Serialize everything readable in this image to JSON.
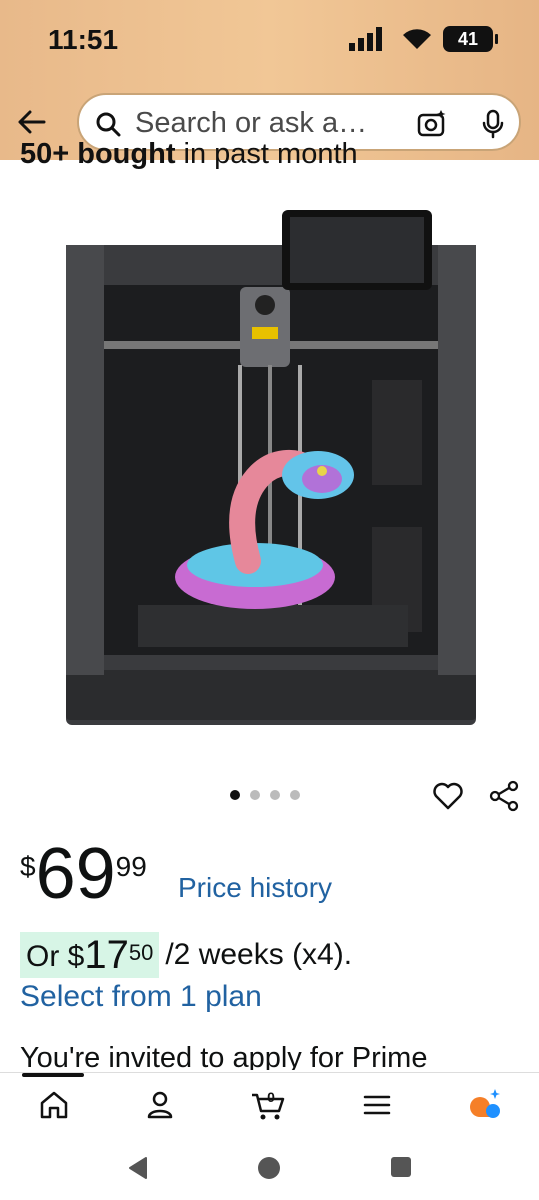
{
  "status_bar": {
    "time": "11:51",
    "battery": "41"
  },
  "search": {
    "placeholder": "Search or ask a…"
  },
  "product": {
    "bought_bold": "50+ bought",
    "bought_rest": " in past month",
    "image_alt": "3D printer with colorful snake print",
    "carousel": {
      "count": 4,
      "active": 1
    }
  },
  "price": {
    "currency": "$",
    "whole": "69",
    "fraction": "99",
    "history_link": "Price history"
  },
  "installment": {
    "or": "Or",
    "currency": "$",
    "whole": "17",
    "fraction": "50",
    "rest": "/2 weeks (x4).",
    "select_link": "Select from 1 plan"
  },
  "promo": {
    "text": "You're invited to apply for Prime"
  },
  "bottom_nav": {
    "cart_count": "0",
    "items": [
      "home-icon",
      "account-icon",
      "cart-icon",
      "menu-icon",
      "rufus-icon"
    ]
  },
  "colors": {
    "header_bg": "#f1c796",
    "link": "#2162a1",
    "highlight": "#d7f5e6",
    "rufus_orange": "#f57f28",
    "rufus_blue": "#1e90ff"
  }
}
